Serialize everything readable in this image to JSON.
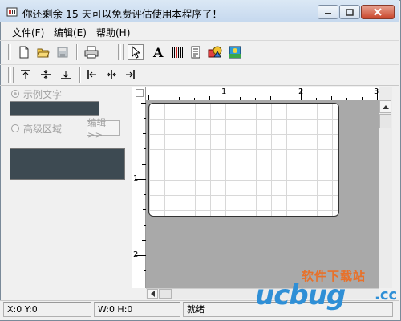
{
  "window": {
    "title": "你还剩余 15 天可以免费评估使用本程序了！"
  },
  "menu": {
    "items": [
      "文件(F)",
      "编辑(E)",
      "帮助(H)"
    ]
  },
  "toolbar": {
    "main_icons": [
      "new-file-icon",
      "open-folder-icon",
      "save-icon",
      "print-icon",
      "select-arrow-icon",
      "text-tool-icon",
      "barcode-tool-icon",
      "document-tool-icon",
      "shape-tool-icon",
      "image-tool-icon"
    ],
    "align_icons": [
      "align-top-icon",
      "align-vcenter-icon",
      "align-bottom-icon",
      "align-left-icon",
      "align-hcenter-icon",
      "align-right-icon"
    ]
  },
  "left_panel": {
    "sample_text_label": "示例文字",
    "advanced_area_label": "高级区域",
    "edit_button_label": "编辑>>"
  },
  "rulers": {
    "horizontal": [
      "1",
      "2",
      "3"
    ],
    "vertical": [
      "1",
      "2"
    ]
  },
  "status": {
    "xy": "X:0    Y:0",
    "wh": "W:0    H:0",
    "state": "就绪"
  },
  "watermark": {
    "site": "软件下载站",
    "brand": "ucbug",
    "suffix": ".cc"
  },
  "colors": {
    "title_bg": "#c5d8ee",
    "close_btn": "#c9452b",
    "panel_dark": "#3d4a52",
    "workspace": "#a9a9a9",
    "watermark_blue": "#2f8fd6",
    "watermark_orange": "#e8712a"
  }
}
